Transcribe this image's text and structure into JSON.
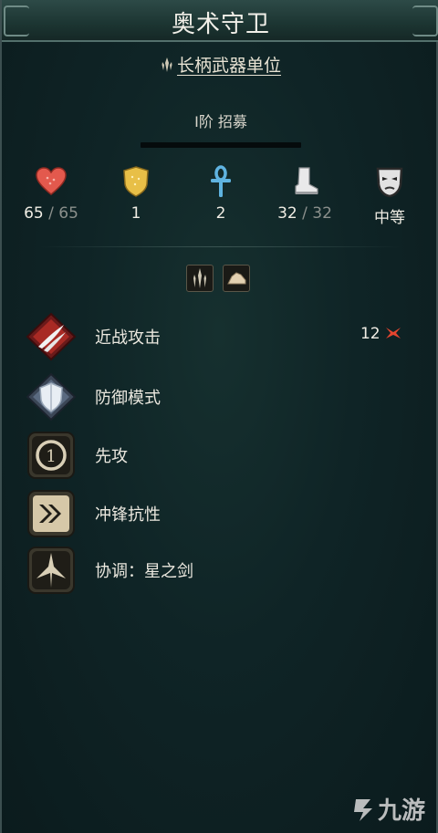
{
  "unit": {
    "name": "奥术守卫",
    "category": "长柄武器单位",
    "tier_recruit": "I阶  招募"
  },
  "stats": {
    "hp_current": "65",
    "hp_max": "/ 65",
    "armor": "1",
    "resistance": "2",
    "movement_current": "32",
    "movement_max": "/ 32",
    "morale": "中等",
    "icons": [
      "heart-icon",
      "shield-icon",
      "ankh-icon",
      "boot-icon",
      "mask-icon"
    ]
  },
  "traits": [
    "polearm-trait-icon",
    "boot-trait-icon"
  ],
  "abilities": [
    {
      "label": "近战攻击",
      "value": "12",
      "icon": "melee-attack-icon"
    },
    {
      "label": "防御模式",
      "icon": "defense-mode-icon"
    },
    {
      "label": "先攻",
      "icon": "first-strike-icon"
    },
    {
      "label": "冲锋抗性",
      "icon": "charge-resistance-icon"
    },
    {
      "label": "协调：星之剑",
      "icon": "star-sword-icon"
    }
  ],
  "colors": {
    "background": "#0f2426",
    "header": "#1c3532",
    "text": "#ebe8df",
    "hp": "#e85a4f",
    "armor": "#e9c14b",
    "resist": "#4fa6d8"
  },
  "watermark": "九游"
}
